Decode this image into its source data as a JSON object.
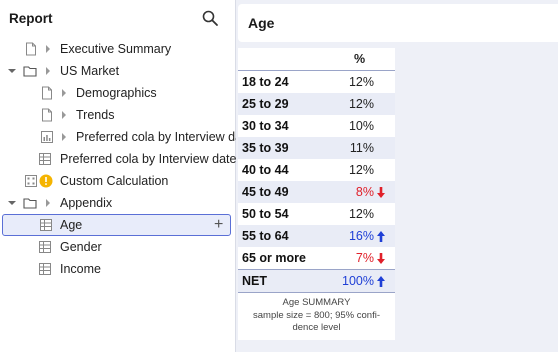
{
  "sidebar": {
    "title": "Report",
    "items": [
      {
        "label": "Executive Summary",
        "icon": "page-icon"
      },
      {
        "label": "US Market",
        "icon": "folder-icon"
      },
      {
        "label": "Demographics",
        "icon": "page-icon"
      },
      {
        "label": "Trends",
        "icon": "page-icon"
      },
      {
        "label": "Preferred cola by Interview date",
        "icon": "chart-icon"
      },
      {
        "label": "Preferred cola by Interview date",
        "icon": "table-icon"
      },
      {
        "label": "Custom Calculation",
        "icon": "calculator-icon",
        "warning": true
      },
      {
        "label": "Appendix",
        "icon": "folder-icon"
      },
      {
        "label": "Age",
        "icon": "table-icon",
        "selected": true,
        "action": "+"
      },
      {
        "label": "Gender",
        "icon": "table-icon"
      },
      {
        "label": "Income",
        "icon": "table-icon"
      }
    ]
  },
  "main": {
    "title": "Age",
    "table": {
      "header": "%",
      "rows": [
        {
          "label": "18 to 24",
          "value": "12%",
          "sig": "none"
        },
        {
          "label": "25 to 29",
          "value": "12%",
          "sig": "none"
        },
        {
          "label": "30 to 34",
          "value": "10%",
          "sig": "none"
        },
        {
          "label": "35 to 39",
          "value": "11%",
          "sig": "none"
        },
        {
          "label": "40 to 44",
          "value": "12%",
          "sig": "none"
        },
        {
          "label": "45 to 49",
          "value": "8%",
          "sig": "down"
        },
        {
          "label": "50 to 54",
          "value": "12%",
          "sig": "none"
        },
        {
          "label": "55 to 64",
          "value": "16%",
          "sig": "up"
        },
        {
          "label": "65 or more",
          "value": "7%",
          "sig": "down"
        },
        {
          "label": "NET",
          "value": "100%",
          "sig": "up"
        }
      ],
      "footnote_line1": "Age SUMMARY",
      "footnote_line2": "sample size = 800; 95% confi-",
      "footnote_line3": "dence level"
    }
  },
  "colors": {
    "accent": "#5a6fd6",
    "up": "#1f3fd6",
    "down": "#e0202a",
    "warning": "#f5b400"
  }
}
